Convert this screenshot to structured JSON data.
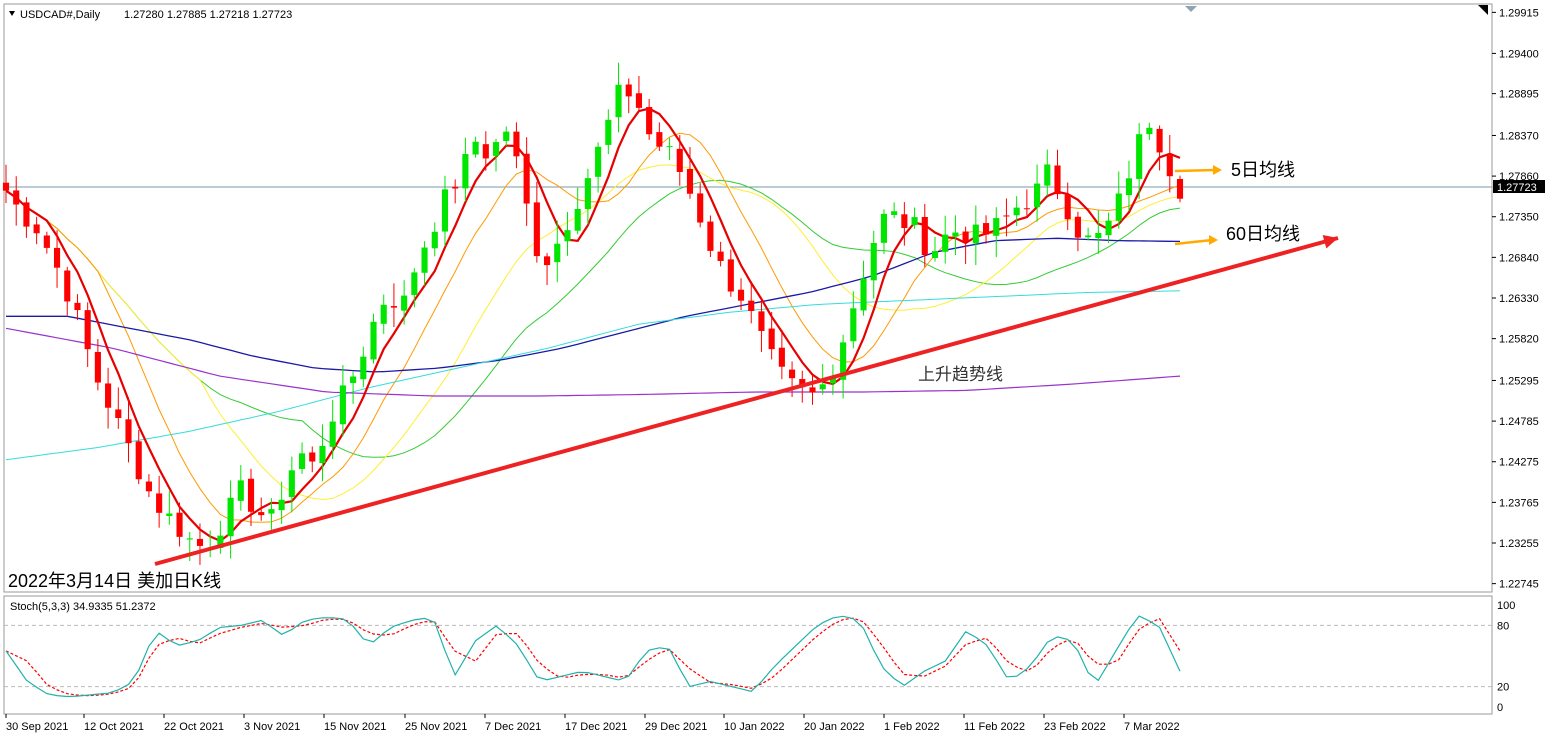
{
  "header": {
    "symbol": "USDCAD#,Daily",
    "ohlc": "1.27280 1.27885 1.27218 1.27723"
  },
  "sub_header": {
    "label": "Stoch(5,3,3) 34.9335 51.2372"
  },
  "annotations": {
    "ma5": "5日均线",
    "ma60": "60日均线",
    "trendline": "上升趋势线",
    "caption": "2022年3月14日 美加日K线"
  },
  "colors": {
    "bull": "#00e600",
    "bear": "#ff0000",
    "ma5": "#e60000",
    "ma10": "#ff9900",
    "ma20": "#ffee33",
    "ma30": "#33cc33",
    "ma60": "#1a1aa6",
    "ma120": "#33dddd",
    "ma200": "#9933cc",
    "trend": "#ee2222",
    "arrow": "#ffaa00",
    "stoch_main": "#20b2aa",
    "stoch_signal": "#ff0000"
  },
  "chart_data": {
    "type": "candlestick",
    "price_axis": {
      "ticks": [
        1.29915,
        1.294,
        1.28895,
        1.2837,
        1.2786,
        1.2735,
        1.2684,
        1.2633,
        1.2582,
        1.25295,
        1.24785,
        1.24275,
        1.23765,
        1.23255,
        1.22745
      ],
      "current_price": 1.27723,
      "range": [
        1.2264,
        1.3002
      ]
    },
    "x_labels": [
      "30 Sep 2021",
      "12 Oct 2021",
      "22 Oct 2021",
      "3 Nov 2021",
      "15 Nov 2021",
      "25 Nov 2021",
      "7 Dec 2021",
      "17 Dec 2021",
      "29 Dec 2021",
      "10 Jan 2022",
      "20 Jan 2022",
      "1 Feb 2022",
      "11 Feb 2022",
      "23 Feb 2022",
      "7 Mar 2022"
    ],
    "stoch_axis": {
      "ticks": [
        100,
        80,
        20,
        0
      ],
      "levels": [
        80,
        20
      ]
    },
    "close_anchors": [
      1.2768,
      1.274,
      1.2725,
      1.269,
      1.265,
      1.26,
      1.254,
      1.25,
      1.246,
      1.242,
      1.238,
      1.236,
      1.234,
      1.232,
      1.233,
      1.236,
      1.239,
      1.237,
      1.235,
      1.24,
      1.244,
      1.242,
      1.248,
      1.251,
      1.255,
      1.26,
      1.264,
      1.262,
      1.268,
      1.272,
      1.276,
      1.279,
      1.283,
      1.281,
      1.285,
      1.279,
      1.27,
      1.268,
      1.272,
      1.276,
      1.28,
      1.285,
      1.29,
      1.288,
      1.283,
      1.282,
      1.279,
      1.275,
      1.27,
      1.266,
      1.264,
      1.26,
      1.256,
      1.253,
      1.2515,
      1.251,
      1.253,
      1.258,
      1.264,
      1.27,
      1.274,
      1.273,
      1.272,
      1.269,
      1.271,
      1.272,
      1.271,
      1.2715,
      1.273,
      1.275,
      1.276,
      1.279,
      1.276,
      1.272,
      1.27,
      1.272,
      1.276,
      1.282,
      1.286,
      1.281,
      1.2772
    ],
    "ma60_anchors": [
      1.261,
      1.261,
      1.2595,
      1.258,
      1.256,
      1.2545,
      1.254,
      1.2545,
      1.2555,
      1.257,
      1.259,
      1.261,
      1.2625,
      1.264,
      1.266,
      1.269,
      1.2705,
      1.2708,
      1.2705,
      1.2704
    ],
    "stoch_main_anchors": [
      55,
      25,
      12,
      10,
      12,
      14,
      25,
      75,
      60,
      65,
      78,
      80,
      85,
      70,
      85,
      88,
      86,
      60,
      78,
      85,
      88,
      30,
      65,
      80,
      60,
      25,
      30,
      35,
      30,
      25,
      55,
      60,
      20,
      25,
      20,
      15,
      40,
      60,
      80,
      90,
      85,
      40,
      20,
      35,
      45,
      75,
      60,
      25,
      40,
      70,
      65,
      20,
      55,
      90,
      80,
      35
    ],
    "stoch_signal_anchors": [
      55,
      45,
      20,
      12,
      11,
      13,
      20,
      60,
      68,
      62,
      72,
      78,
      82,
      78,
      80,
      86,
      86,
      72,
      70,
      80,
      86,
      55,
      45,
      72,
      72,
      42,
      28,
      32,
      32,
      28,
      45,
      58,
      38,
      24,
      22,
      18,
      30,
      50,
      70,
      85,
      88,
      62,
      32,
      30,
      40,
      62,
      68,
      42,
      34,
      58,
      68,
      42,
      42,
      75,
      88,
      55
    ]
  }
}
